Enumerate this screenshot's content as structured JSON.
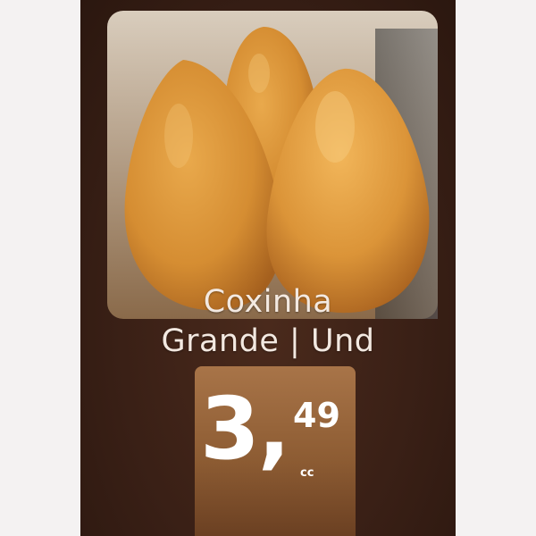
{
  "product": {
    "name_line1": "Coxinha",
    "name_line2": "Grande | Und",
    "image": "coxinha-photo"
  },
  "price": {
    "integer": "3,",
    "cents": "49",
    "unit": "cc"
  },
  "colors": {
    "background": "#3a2016",
    "price_box": "#8d5c33",
    "text": "#f3e9e1"
  }
}
